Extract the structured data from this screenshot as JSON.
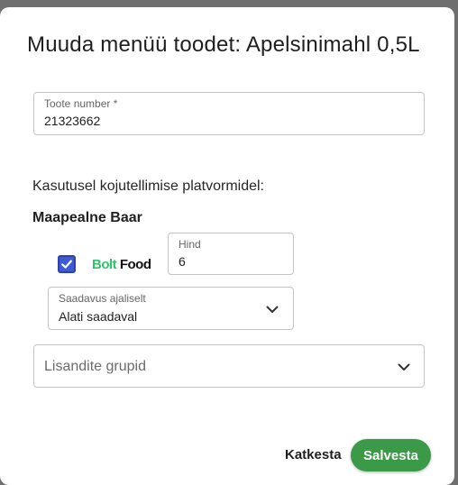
{
  "dialog": {
    "title": "Muuda menüü toodet: Apelsinimahl 0,5L"
  },
  "product_number": {
    "label": "Toote number *",
    "value": "21323662"
  },
  "platforms_heading": "Kasutusel kojutellimise platvormidel:",
  "venue": {
    "name": "Maapealne Baar",
    "platform": {
      "enabled": true,
      "logo_text_1": "Bolt",
      "logo_text_2": " Food",
      "price": {
        "label": "Hind",
        "value": "6"
      },
      "availability": {
        "label": "Saadavus ajaliselt",
        "selected": "Alati saadaval"
      }
    }
  },
  "addon_groups": {
    "placeholder": "Lisandite grupid"
  },
  "actions": {
    "cancel_label": "Katkesta",
    "save_label": "Salvesta"
  },
  "colors": {
    "primary_button": "#3a9a47",
    "checkbox": "#3d5bd6",
    "bolt_green": "#2fc36b"
  },
  "icons": {
    "dropdown": "chevron-down-icon",
    "checkbox": "checkmark-icon"
  }
}
